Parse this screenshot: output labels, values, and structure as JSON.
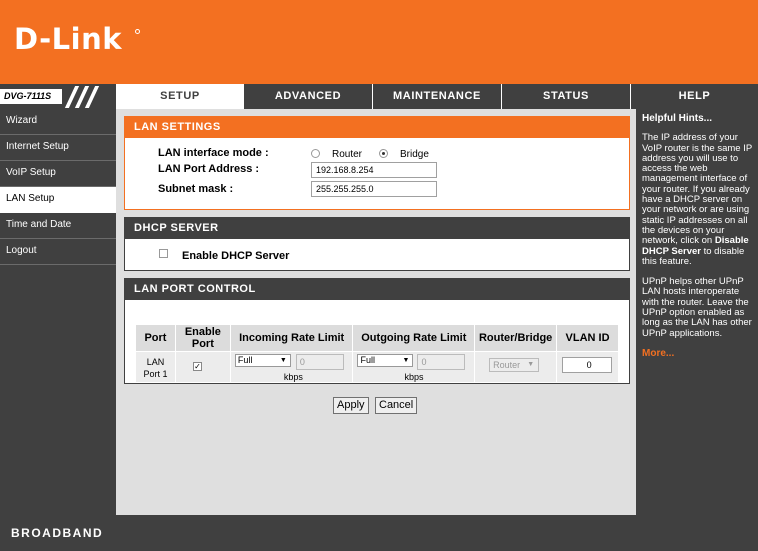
{
  "brand": {
    "logo": "D-Link",
    "model": "DVG-7111S",
    "footer": "BROADBAND"
  },
  "tabs": [
    {
      "label": "SETUP",
      "active": true
    },
    {
      "label": "ADVANCED",
      "active": false
    },
    {
      "label": "MAINTENANCE",
      "active": false
    },
    {
      "label": "STATUS",
      "active": false
    },
    {
      "label": "HELP",
      "active": false
    }
  ],
  "sidebar": {
    "items": [
      {
        "label": "Wizard",
        "active": false
      },
      {
        "label": "Internet Setup",
        "active": false
      },
      {
        "label": "VoIP Setup",
        "active": false
      },
      {
        "label": "LAN Setup",
        "active": true
      },
      {
        "label": "Time and Date",
        "active": false
      },
      {
        "label": "Logout",
        "active": false
      }
    ]
  },
  "lan_settings": {
    "title": "LAN SETTINGS",
    "mode_label": "LAN interface mode :",
    "mode_options": [
      "Router",
      "Bridge"
    ],
    "mode_selected": "Bridge",
    "address_label": "LAN Port Address :",
    "address_value": "192.168.8.254",
    "mask_label": "Subnet mask :",
    "mask_value": "255.255.255.0"
  },
  "dhcp": {
    "title": "DHCP SERVER",
    "enable_label": "Enable DHCP Server",
    "enabled": false
  },
  "port_control": {
    "title": "LAN PORT CONTROL",
    "headers": [
      "Port",
      "Enable Port",
      "Incoming Rate Limit",
      "Outgoing Rate Limit",
      "Router/Bridge",
      "VLAN ID"
    ],
    "row": {
      "port": "LAN Port 1",
      "enabled": true,
      "incoming_select": "Full",
      "incoming_value": "0",
      "incoming_unit": "kbps",
      "outgoing_select": "Full",
      "outgoing_value": "0",
      "outgoing_unit": "kbps",
      "router_bridge": "Router",
      "vlan_id": "0"
    }
  },
  "buttons": {
    "apply": "Apply",
    "cancel": "Cancel"
  },
  "hints": {
    "title": "Helpful Hints...",
    "p1_a": "The IP address of your VoIP router is the same IP address you will use to access the web management interface of your router. If you already have a DHCP server on your network or are using static IP addresses on all the devices on your network, click on ",
    "p1_bold": "Disable DHCP Server",
    "p1_b": " to disable this feature.",
    "p2": "UPnP helps other UPnP LAN hosts interoperate with the router. Leave the UPnP option enabled as long as the LAN has other UPnP applications.",
    "more": "More..."
  },
  "colors": {
    "accent": "#f37021",
    "dark": "#404040",
    "panel": "#dfdfdf"
  }
}
